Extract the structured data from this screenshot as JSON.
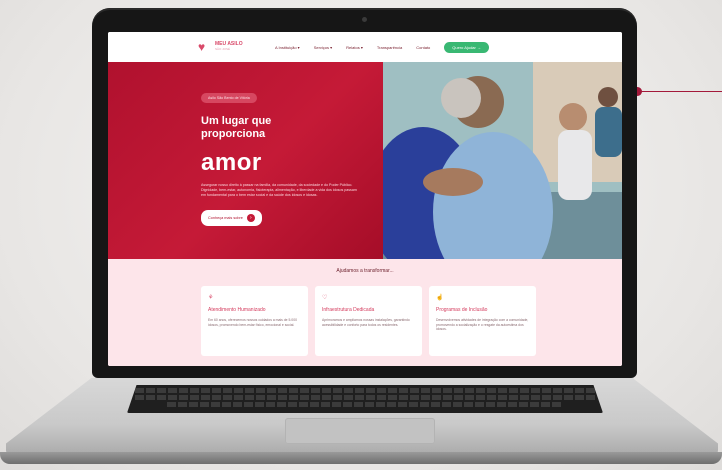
{
  "nav": {
    "logo_title": "Meu Asilo",
    "logo_sub": "São José",
    "items": [
      {
        "label": "A Instituição ▾"
      },
      {
        "label": "Serviços ▾"
      },
      {
        "label": "Relatos ▾"
      },
      {
        "label": "Transparência"
      },
      {
        "label": "Contato"
      }
    ],
    "cta": "Quero Ajudar →"
  },
  "hero": {
    "badge": "Asilo São Bento de Vitória",
    "title": "Um lugar que proporciona",
    "highlight": "amor",
    "description": "Assegurar nosso direito à passar na família, da comunidade, da sociedade e do Poder Público. Dignidade, bem-estar, autonomia, fisioterapia, alimentação, e liberdade a vida dos idosos passam em fundamental para o bem estar social e da saúde dos idosos e idosas.",
    "button_label": "Conheça mais sobre",
    "button_icon": "arrow-right"
  },
  "section": {
    "title": "Ajudamos a transformar...",
    "cards": [
      {
        "icon": "hands-icon",
        "title": "Atendimento Humanizado",
        "text": "Em 60 anos, oferecemos nossos cuidados a mais de 5.000 idosos, promovendo bem-estar físico, emocional e social."
      },
      {
        "icon": "heart-icon",
        "title": "Infraestrutura Dedicada",
        "text": "Aprimoramos e ampliamos nossas instalações, garantindo acessibilidade e conforto para todos os residentes."
      },
      {
        "icon": "hand-icon",
        "title": "Programas de Inclusão",
        "text": "Desenvolvemos atividades de integração com a comunidade, promovendo a socialização e o resgate da autoestima dos idosos."
      }
    ]
  },
  "colors": {
    "brand": "#c51a37",
    "accent": "#d94a6a",
    "cta": "#39b873"
  }
}
